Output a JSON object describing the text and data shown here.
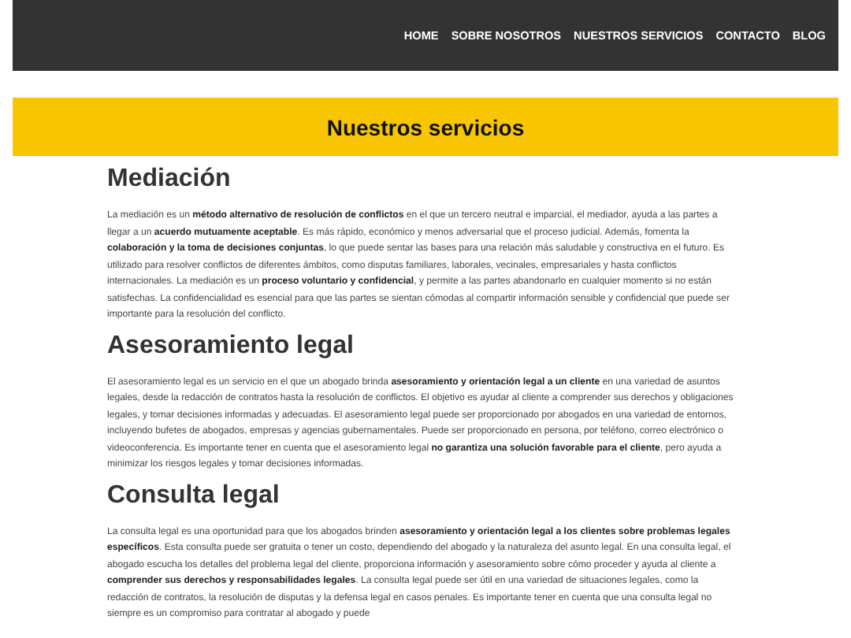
{
  "nav": {
    "items": [
      {
        "label": "HOME"
      },
      {
        "label": "SOBRE NOSOTROS"
      },
      {
        "label": "NUESTROS SERVICIOS"
      },
      {
        "label": "CONTACTO"
      },
      {
        "label": "BLOG"
      }
    ]
  },
  "banner": {
    "title": "Nuestros servicios"
  },
  "sections": [
    {
      "heading": "Mediación",
      "text": "La mediación es un **método alternativo de resolución de conflictos** en el que un tercero neutral e imparcial, el mediador, ayuda a las partes a llegar a un **acuerdo mutuamente aceptable**. Es más rápido, económico y menos adversarial que el proceso judicial. Además, fomenta la **colaboración y la toma de decisiones conjuntas**, lo que puede sentar las bases para una relación más saludable y constructiva en el futuro. Es utilizado para resolver conflictos de diferentes ámbitos, como disputas familiares, laborales, vecinales, empresariales y hasta conflictos internacionales. La mediación es un **proceso voluntario y confidencial**, y permite a las partes abandonarlo en cualquier momento si no están satisfechas. La confidencialidad es esencial para que las partes se sientan cómodas al compartir información sensible y confidencial que puede ser importante para la resolución del conflicto."
    },
    {
      "heading": "Asesoramiento legal",
      "text": "El asesoramiento legal es un servicio en el que un abogado brinda **asesoramiento y orientación legal a un cliente** en una variedad de asuntos legales, desde la redacción de contratos hasta la resolución de conflictos. El objetivo es ayudar al cliente a comprender sus derechos y obligaciones legales, y tomar decisiones informadas y adecuadas. El asesoramiento legal puede ser proporcionado por abogados en una variedad de entornos, incluyendo bufetes de abogados, empresas y agencias gubernamentales. Puede ser proporcionado en persona, por teléfono, correo electrónico o videoconferencia. Es importante tener en cuenta que el asesoramiento legal **no garantiza una solución favorable para el cliente**, pero ayuda a minimizar los riesgos legales y tomar decisiones informadas."
    },
    {
      "heading": "Consulta legal",
      "text": "La consulta legal es una oportunidad para que los abogados brinden **asesoramiento y orientación legal a los clientes sobre problemas legales específicos**. Esta consulta puede ser gratuita o tener un costo, dependiendo del abogado y la naturaleza del asunto legal. En una consulta legal, el abogado escucha los detalles del problema legal del cliente, proporciona información y asesoramiento sobre cómo proceder y ayuda al cliente a **comprender sus derechos y responsabilidades legales**. La consulta legal puede ser útil en una variedad de situaciones legales, como la redacción de contratos, la resolución de disputas y la defensa legal en casos penales. Es importante tener en cuenta que una consulta legal no siempre es un compromiso para contratar al abogado y puede"
    }
  ]
}
